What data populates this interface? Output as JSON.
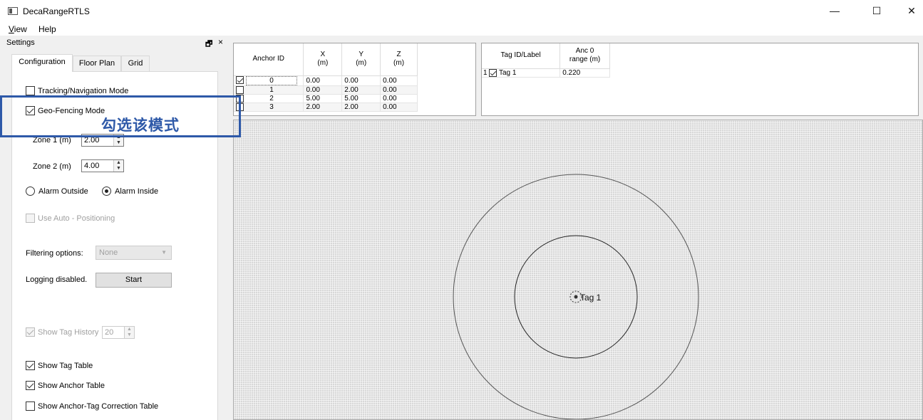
{
  "window": {
    "title": "DecaRangeRTLS",
    "minimize": "—",
    "maximize": "☐",
    "close": "✕"
  },
  "menu": {
    "view_first": "V",
    "view_rest": "iew",
    "help": "Help"
  },
  "settings": {
    "title": "Settings",
    "float_icon": "🗗",
    "close_icon": "×",
    "tabs": [
      {
        "label": "Configuration",
        "active": true
      },
      {
        "label": "Floor Plan",
        "active": false
      },
      {
        "label": "Grid",
        "active": false
      }
    ],
    "tracking_mode": {
      "label": "Tracking/Navigation Mode",
      "checked": false
    },
    "geofencing_mode": {
      "label": "Geo-Fencing Mode",
      "checked": true
    },
    "zone1": {
      "label": "Zone 1 (m)",
      "value": "2.00"
    },
    "zone2": {
      "label": "Zone 2 (m)",
      "value": "4.00"
    },
    "alarm_outside": {
      "label": "Alarm Outside",
      "selected": false
    },
    "alarm_inside": {
      "label": "Alarm Inside",
      "selected": true
    },
    "auto_positioning": {
      "label": "Use Auto - Positioning",
      "checked": false
    },
    "filtering": {
      "label": "Filtering options:",
      "value": "None"
    },
    "logging": {
      "label": "Logging disabled.",
      "button": "Start"
    },
    "tag_history": {
      "label": "Show Tag History",
      "value": "20",
      "checked": true
    },
    "show_tag_table": {
      "label": "Show Tag Table",
      "checked": true
    },
    "show_anchor_table": {
      "label": "Show Anchor Table",
      "checked": true
    },
    "show_correction_table": {
      "label": "Show Anchor-Tag Correction Table",
      "checked": false
    }
  },
  "annotation": {
    "text": "勾选该模式"
  },
  "anchor_table": {
    "headers": {
      "id": "Anchor ID",
      "x1": "X",
      "x2": "(m)",
      "y1": "Y",
      "y2": "(m)",
      "z1": "Z",
      "z2": "(m)"
    },
    "rows": [
      {
        "checked": true,
        "id": "0",
        "x": "0.00",
        "y": "0.00",
        "z": "0.00"
      },
      {
        "checked": false,
        "id": "1",
        "x": "0.00",
        "y": "2.00",
        "z": "0.00"
      },
      {
        "checked": false,
        "id": "2",
        "x": "5.00",
        "y": "5.00",
        "z": "0.00"
      },
      {
        "checked": false,
        "id": "3",
        "x": "2.00",
        "y": "2.00",
        "z": "0.00"
      }
    ]
  },
  "tag_table": {
    "headers": {
      "label": "Tag ID/Label",
      "range1": "Anc 0",
      "range2": "range (m)"
    },
    "rows": [
      {
        "index": "1",
        "checked": true,
        "label": "Tag 1",
        "range": "0.220"
      }
    ]
  },
  "plot": {
    "tag_label": "Tag 1",
    "zone_inner_m": 2.0,
    "zone_outer_m": 4.0
  }
}
